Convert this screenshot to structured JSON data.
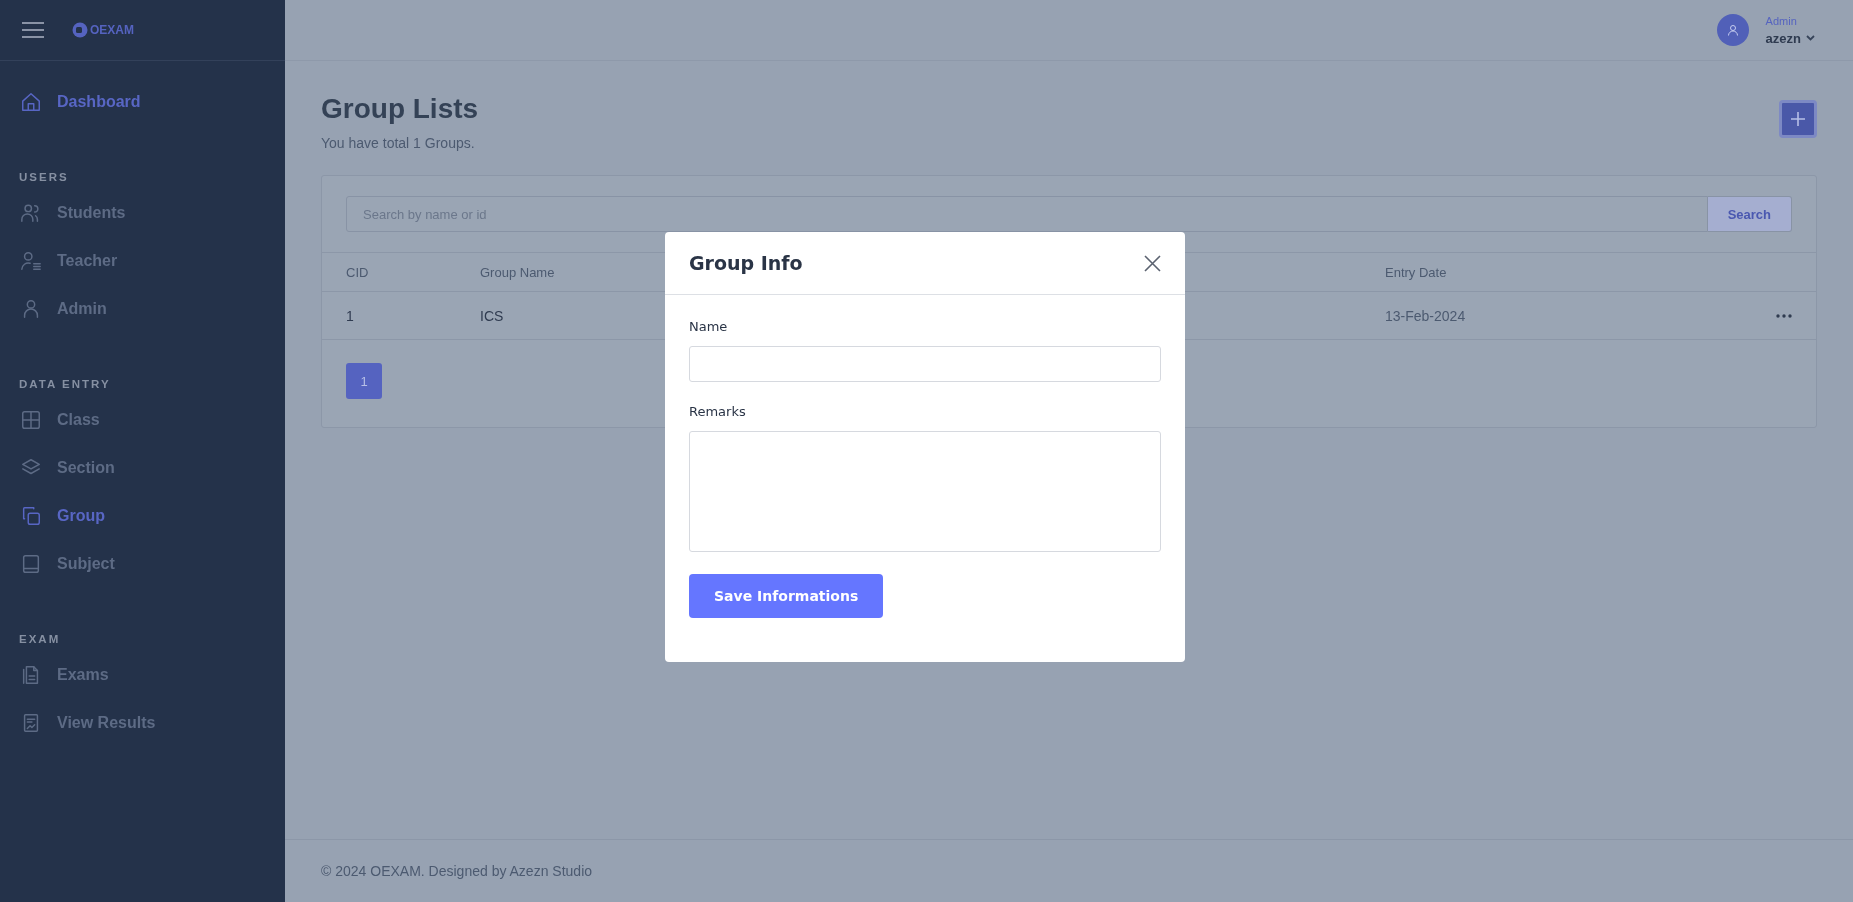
{
  "sidebar": {
    "logo": "OEXAM",
    "sections": [
      {
        "items": [
          {
            "label": "Dashboard",
            "kind": "home",
            "selected": true
          }
        ]
      },
      {
        "heading": "USERS",
        "items": [
          {
            "label": "Students",
            "kind": "users",
            "selected": false
          },
          {
            "label": "Teacher",
            "kind": "user-list",
            "selected": false
          },
          {
            "label": "Admin",
            "kind": "user",
            "selected": false
          }
        ]
      },
      {
        "heading": "DATA ENTRY",
        "items": [
          {
            "label": "Class",
            "kind": "grid",
            "selected": false
          },
          {
            "label": "Section",
            "kind": "layers",
            "selected": false
          },
          {
            "label": "Group",
            "kind": "copy",
            "selected": true
          },
          {
            "label": "Subject",
            "kind": "book",
            "selected": false
          }
        ]
      },
      {
        "heading": "EXAM",
        "items": [
          {
            "label": "Exams",
            "kind": "file",
            "selected": false
          },
          {
            "label": "View Results",
            "kind": "report",
            "selected": false
          }
        ]
      }
    ]
  },
  "header": {
    "role": "Admin",
    "name": "azezn"
  },
  "page": {
    "title": "Group Lists",
    "subtitle": "You have total 1 Groups."
  },
  "search": {
    "placeholder": "Search by name or id",
    "button": "Search"
  },
  "table": {
    "columns": [
      "CID",
      "Group Name",
      "Entry Date"
    ],
    "rows": [
      {
        "cid": "1",
        "group_name": "ICS",
        "entry_date": "13-Feb-2024"
      }
    ]
  },
  "pagination": [
    {
      "label": "1",
      "selected": true
    }
  ],
  "modal": {
    "title": "Group Info",
    "fields": [
      {
        "label": "Name",
        "kind": "input"
      },
      {
        "label": "Remarks",
        "kind": "textarea"
      }
    ],
    "save_button": "Save Informations"
  },
  "footer": "© 2024 OEXAM. Designed by Azezn Studio"
}
